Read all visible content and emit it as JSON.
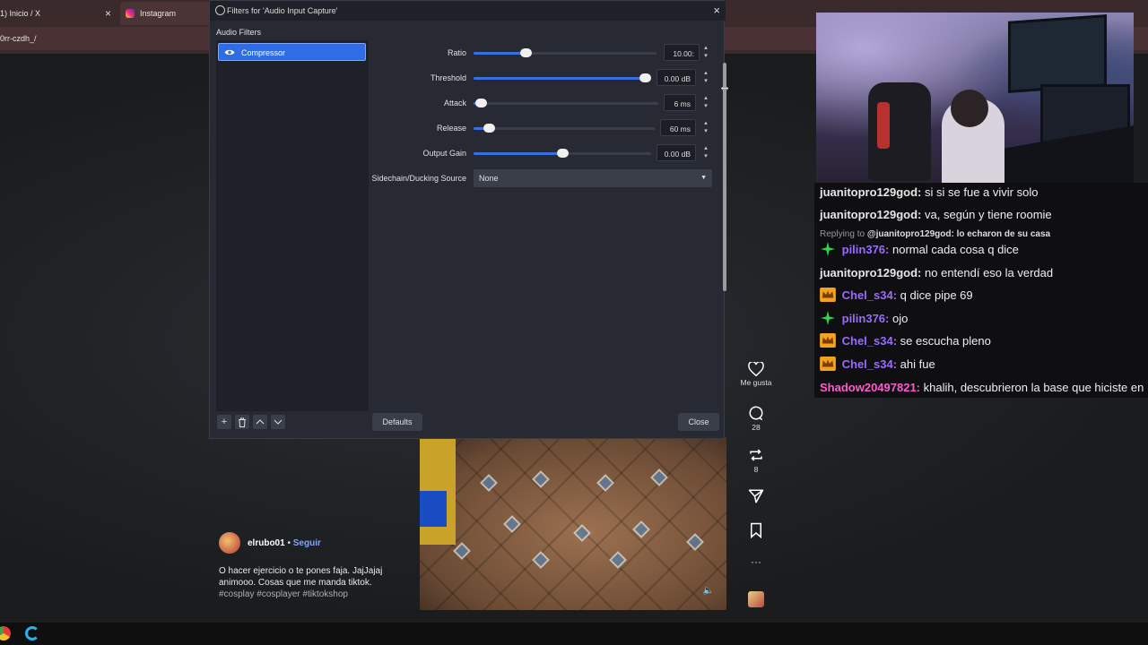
{
  "browser": {
    "tabs": [
      {
        "label": "1) Inicio / X"
      },
      {
        "label": "Instagram"
      }
    ],
    "address": "0rr-czdh_/"
  },
  "obs": {
    "title": "Filters for 'Audio Input Capture'",
    "filters_label": "Audio Filters",
    "filters": [
      "Compressor"
    ],
    "properties": {
      "ratio": {
        "label": "Ratio",
        "value": "10.00:",
        "level": 0.27
      },
      "threshold": {
        "label": "Threshold",
        "value": "0.00 dB",
        "level": 1.0
      },
      "attack": {
        "label": "Attack",
        "value": "6 ms",
        "level": 0.01
      },
      "release": {
        "label": "Release",
        "value": "60 ms",
        "level": 0.06
      },
      "output_gain": {
        "label": "Output Gain",
        "value": "0.00 dB",
        "level": 0.5
      },
      "sidechain": {
        "label": "Sidechain/Ducking Source",
        "value": "None"
      }
    },
    "defaults_label": "Defaults",
    "close_label": "Close"
  },
  "post": {
    "actions": {
      "like_label": "Me gusta",
      "comments_count": "28",
      "reposts_count": "8"
    },
    "author": "elrubo01",
    "separator": "•",
    "follow_label": "Seguir",
    "caption_line1": "O hacer ejercicio o te pones faja. JajJajaj",
    "caption_line2": "animooo. Cosas que me manda tiktok.",
    "hashtags": "#cosplay #cosplayer #tiktokshop"
  },
  "chat": {
    "messages": [
      {
        "user": "juanitopro129god:",
        "text": "si si se fue a vivir solo",
        "color": "#e6e6e6",
        "badge": null
      },
      {
        "user": "juanitopro129god:",
        "text": "va, según y tiene roomie",
        "color": "#e6e6e6",
        "badge": null
      },
      {
        "user": "pilin376:",
        "text": "normal cada cosa q dice",
        "color": "#9b6bff",
        "badge": "green-star"
      },
      {
        "user": "juanitopro129god:",
        "text": "no entendí eso la verdad",
        "color": "#e6e6e6",
        "badge": null
      },
      {
        "user": "Chel_s34:",
        "text": "q dice pipe 69",
        "color": "#9b6bff",
        "badge": "crown"
      },
      {
        "user": "pilin376:",
        "text": "ojo",
        "color": "#9b6bff",
        "badge": "green-star"
      },
      {
        "user": "Chel_s34:",
        "text": "se escucha pleno",
        "color": "#9b6bff",
        "badge": "crown"
      },
      {
        "user": "Chel_s34:",
        "text": "ahi fue",
        "color": "#9b6bff",
        "badge": "crown"
      },
      {
        "user": "Shadow20497821:",
        "text": "khalih, descubrieron la base que hiciste en",
        "color": "#ff5bd0",
        "badge": null
      }
    ],
    "reply": {
      "prefix": "Replying to",
      "mention": "@juanitopro129god:",
      "text": "lo echaron de su casa"
    }
  },
  "colors": {
    "obs_accent": "#2f6ce5",
    "slider_fill": "#3a6fe0",
    "chat_bg": "#0f0f11"
  }
}
